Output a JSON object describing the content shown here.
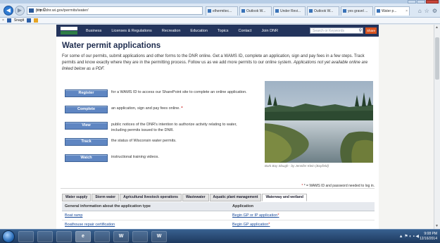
{
  "browser": {
    "url": "http://dnr.wi.gov/permits/water/",
    "url_actions": "ρ ▾ C",
    "tabs": [
      {
        "label": "elhermitec...",
        "active": false
      },
      {
        "label": "Outlook W...",
        "active": false
      },
      {
        "label": "Under Revi...",
        "active": false
      },
      {
        "label": "Outlook W...",
        "active": false
      },
      {
        "label": "yes gravel ...",
        "active": false
      },
      {
        "label": "Water p...",
        "active": true
      }
    ],
    "tab_close": "×",
    "favorites": [
      "Snagit"
    ],
    "favorites_close": "×"
  },
  "site": {
    "nav": [
      "Business",
      "Licenses & Regulations",
      "Recreation",
      "Education",
      "Topics",
      "Contact",
      "Join DNR"
    ],
    "search_placeholder": "Search or Keywords",
    "share_label": "Share"
  },
  "page": {
    "title": "Water permit applications",
    "intro_1": "For some of our permits, submit applications and other forms to the DNR online. Get a WAMS ID, complete an application, sign and pay fees in a few steps. Track permits and know exactly where they are in the permitting process. Follow us as we add more permits to our online system.",
    "intro_2": "Applications not yet available online are linked below as a PDF.",
    "actions": [
      {
        "button": "Register",
        "text": "for a WAMS ID to access our SharePoint site to complete an online application.",
        "required": false
      },
      {
        "button": "Complete",
        "text": "an application, sign and pay fees online.",
        "required": true
      },
      {
        "button": "View",
        "text": "public notices of the DNR's intention to authorize activity relating to water, including permits issued to the DNR.",
        "required": false
      },
      {
        "button": "Track",
        "text": "the status of Wisconsin water permits.",
        "required": false
      },
      {
        "button": "Watch",
        "text": "instructional training videos.",
        "required": false
      }
    ],
    "photo_caption": "Bark Bay Slough - by Jennifer Klein (Bayfield)",
    "footnote": "* = WAMS ID and password needed to log in.",
    "required_marker": "*",
    "permit_tabs": [
      {
        "label": "Water supply",
        "active": false
      },
      {
        "label": "Storm water",
        "active": false
      },
      {
        "label": "Agricultural livestock operations",
        "active": false
      },
      {
        "label": "Wastewater",
        "active": false
      },
      {
        "label": "Aquatic plant management",
        "active": false
      },
      {
        "label": "Waterway and wetland",
        "active": true
      }
    ],
    "table": {
      "headers": [
        "General information about the application type",
        "Application"
      ],
      "rows": [
        {
          "info": "Boat ramp",
          "application": "Begin GP or IP application",
          "required": true
        },
        {
          "info": "Boathouse repair certification",
          "application": "Begin GP application",
          "required": true
        }
      ]
    }
  },
  "taskbar": {
    "apps": [
      "",
      "",
      "",
      "e",
      "",
      "W",
      "",
      "W"
    ],
    "tray": "▲ ⚑ ◐ ▪ ◀",
    "time": "9:08 PM",
    "date": "12/16/2014"
  }
}
